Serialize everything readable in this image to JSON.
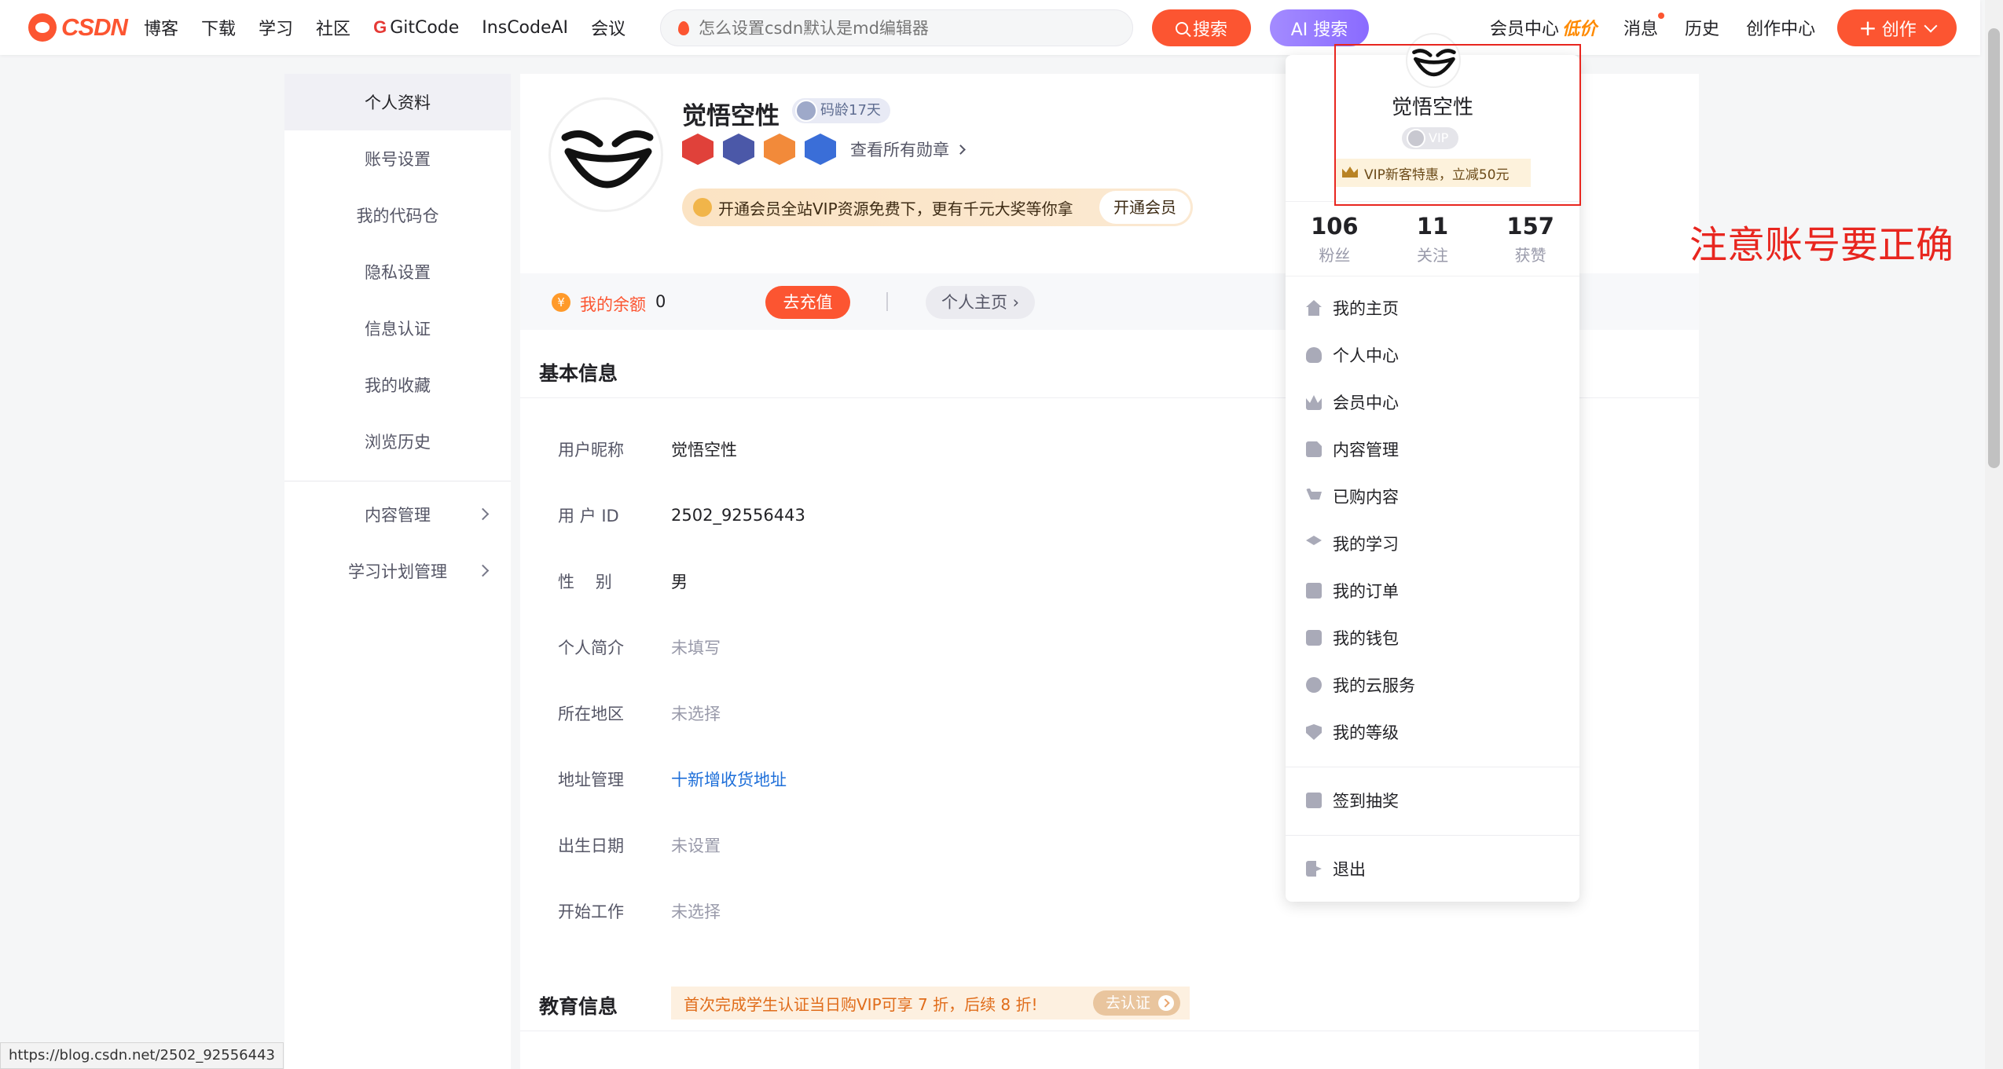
{
  "header": {
    "logo_text": "CSDN",
    "nav": [
      "博客",
      "下载",
      "学习",
      "社区",
      "GitCode",
      "InsCodeAI",
      "会议"
    ],
    "search_placeholder": "怎么设置csdn默认是md编辑器",
    "search_button": "搜索",
    "ai_search_button": "AI 搜索",
    "member_center": "会员中心",
    "member_tag": "低价",
    "messages": "消息",
    "history": "历史",
    "creator_center": "创作中心",
    "create_button": "创作"
  },
  "sidebar": {
    "items": [
      "个人资料",
      "账号设置",
      "我的代码仓",
      "隐私设置",
      "信息认证",
      "我的收藏",
      "浏览历史"
    ],
    "groups": [
      "内容管理",
      "学习计划管理"
    ]
  },
  "profile": {
    "name": "觉悟空性",
    "code_age": "码龄17天",
    "medals_link": "查看所有勋章",
    "vip_banner": "开通会员全站VIP资源免费下，更有千元大奖等你拿",
    "vip_open": "开通会员",
    "balance_label": "我的余额",
    "balance_value": "0",
    "recharge": "去充值",
    "homepage": "个人主页"
  },
  "basic_info": {
    "title": "基本信息",
    "rows": [
      {
        "label": "用户昵称",
        "value": "觉悟空性"
      },
      {
        "label": "用 户 ID",
        "value": "2502_92556443"
      },
      {
        "label": "性    别",
        "value": "男"
      },
      {
        "label": "个人简介",
        "value": "未填写"
      },
      {
        "label": "所在地区",
        "value": "未选择"
      },
      {
        "label": "地址管理",
        "value": "十新增收货地址"
      },
      {
        "label": "出生日期",
        "value": "未设置"
      },
      {
        "label": "开始工作",
        "value": "未选择"
      }
    ]
  },
  "education": {
    "title": "教育信息",
    "banner": "首次完成学生认证当日购VIP可享 7 折，后续 8 折!",
    "button": "去认证"
  },
  "dropdown": {
    "name": "觉悟空性",
    "vip": "VIP",
    "promo": "VIP新客特惠，立减50元",
    "stats": [
      {
        "num": "106",
        "label": "粉丝"
      },
      {
        "num": "11",
        "label": "关注"
      },
      {
        "num": "157",
        "label": "获赞"
      }
    ],
    "menu": [
      "我的主页",
      "个人中心",
      "会员中心",
      "内容管理",
      "已购内容",
      "我的学习",
      "我的订单",
      "我的钱包",
      "我的云服务",
      "我的等级"
    ],
    "checkin": "签到抽奖",
    "logout": "退出"
  },
  "annotation": "注意账号要正确",
  "status_url": "https://blog.csdn.net/2502_92556443",
  "colors": {
    "brand": "#fc5531",
    "annotation": "#e8261f",
    "link": "#1e6fd9"
  }
}
